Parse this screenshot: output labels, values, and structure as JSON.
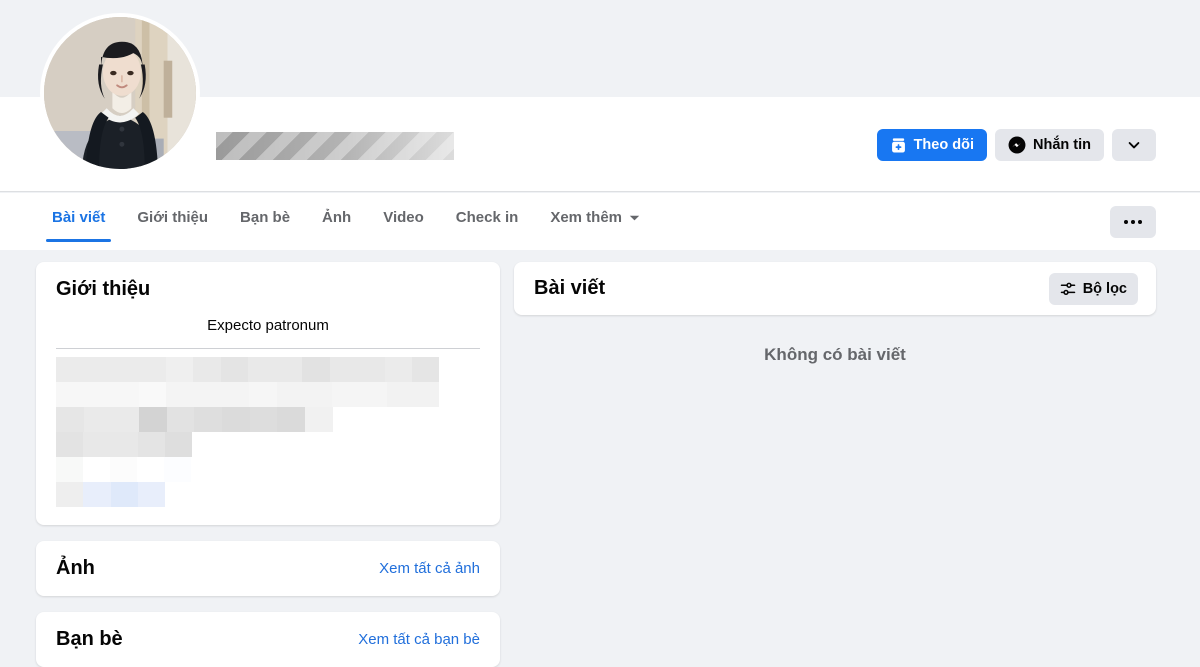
{
  "profile": {
    "avatar_alt": "profile-photo",
    "name_redacted": true,
    "cover_color": "#f0f2f5"
  },
  "actions": {
    "follow_label": "Theo dõi",
    "message_label": "Nhắn tin",
    "follow_icon": "follow-plus-icon",
    "message_icon": "messenger-icon",
    "caret_icon": "chevron-down-icon",
    "more_icon": "ellipsis-icon",
    "accent_color": "#1877f2"
  },
  "nav": {
    "tabs": [
      {
        "label": "Bài viết",
        "active": true
      },
      {
        "label": "Giới thiệu",
        "active": false
      },
      {
        "label": "Bạn bè",
        "active": false
      },
      {
        "label": "Ảnh",
        "active": false
      },
      {
        "label": "Video",
        "active": false
      },
      {
        "label": "Check in",
        "active": false
      },
      {
        "label": "Xem thêm",
        "active": false,
        "has_caret": true
      }
    ],
    "active_color": "#1b74e4"
  },
  "intro": {
    "title": "Giới thiệu",
    "bio": "Expecto patronum",
    "redacted_rows": [
      [
        [
          "#ebebeb",
          110
        ],
        [
          "#efefef",
          27
        ],
        [
          "#e9e9e9",
          28
        ],
        [
          "#e4e4e4",
          27
        ],
        [
          "#e9e9e9",
          54
        ],
        [
          "#e2e2e2",
          28
        ],
        [
          "#e8e8e8",
          55
        ],
        [
          "#ebebeb",
          27
        ],
        [
          "#e5e5e5",
          27
        ]
      ],
      [
        [
          "#f7f7f7",
          83
        ],
        [
          "#f9f9f9",
          27
        ],
        [
          "#f4f4f4",
          83
        ],
        [
          "#f6f6f6",
          28
        ],
        [
          "#f3f3f3",
          55
        ],
        [
          "#f5f5f5",
          55
        ],
        [
          "#f2f2f2",
          52
        ]
      ],
      [
        [
          "#e6e6e6",
          28
        ],
        [
          "#eaeaea",
          55
        ],
        [
          "#d3d3d3",
          28
        ],
        [
          "#e2e2e2",
          27
        ],
        [
          "#dedede",
          28
        ],
        [
          "#dbdbdb",
          28
        ],
        [
          "#dddddd",
          27
        ],
        [
          "#dadada",
          28
        ],
        [
          "#f1f1f1",
          28
        ]
      ],
      [
        [
          "#e3e3e3",
          27
        ],
        [
          "#e8e8e8",
          55
        ],
        [
          "#e4e4e4",
          27
        ],
        [
          "#dedede",
          27
        ]
      ],
      [
        [
          "#f8f9f8",
          27
        ],
        [
          "#ffffff",
          27
        ],
        [
          "#fcfcfc",
          27
        ],
        [
          "#ffffff",
          27
        ],
        [
          "#fcfdff",
          27
        ]
      ],
      [
        [
          "#eeeeee",
          27
        ],
        [
          "#e8eefb",
          28
        ],
        [
          "#dfe9fa",
          27
        ],
        [
          "#e8eefb",
          27
        ]
      ]
    ]
  },
  "photos": {
    "title": "Ảnh",
    "link": "Xem tất cả ảnh"
  },
  "friends": {
    "title": "Bạn bè",
    "link": "Xem tất cả bạn bè"
  },
  "posts": {
    "title": "Bài viết",
    "filter_label": "Bộ lọc",
    "filter_icon": "sliders-icon",
    "empty_message": "Không có bài viết"
  }
}
